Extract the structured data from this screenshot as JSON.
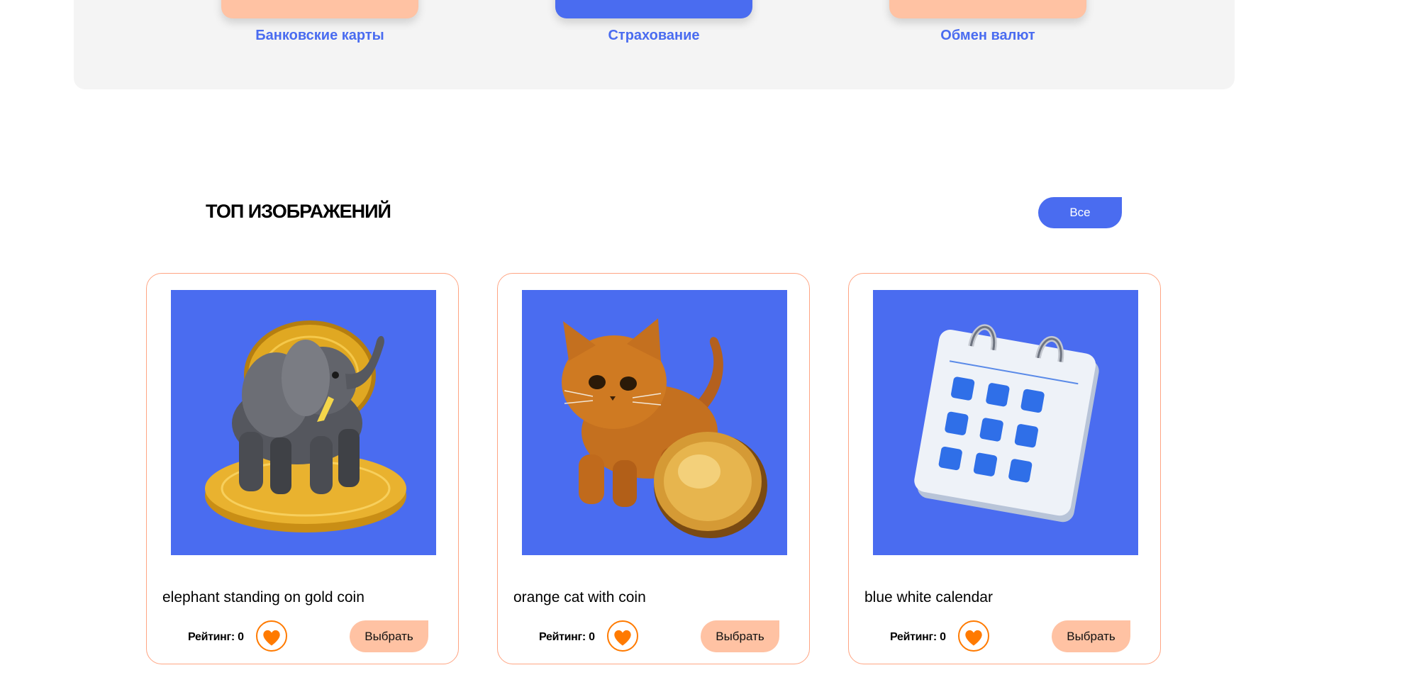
{
  "services": [
    {
      "label": "Банковские карты",
      "tile": "peach"
    },
    {
      "label": "Страхование",
      "tile": "blue"
    },
    {
      "label": "Обмен валют",
      "tile": "peach"
    }
  ],
  "section": {
    "title": "ТОП ИЗОБРАЖЕНИЙ",
    "all_button": "Все"
  },
  "cards": [
    {
      "title": "elephant standing on gold coin",
      "image": "elephant-coin-image",
      "rating": "Рейтинг: 0",
      "choose": "Выбрать"
    },
    {
      "title": "orange cat with coin",
      "image": "cat-coin-image",
      "rating": "Рейтинг: 0",
      "choose": "Выбрать"
    },
    {
      "title": "blue white calendar",
      "image": "calendar-image",
      "rating": "Рейтинг: 0",
      "choose": "Выбрать"
    }
  ],
  "colors": {
    "accent_blue": "#4a6cf0",
    "peach": "#ffc2a3",
    "card_border": "#ffa583",
    "heart_orange": "#ff7a00",
    "panel_bg": "#f4f4f4"
  },
  "icons": {
    "like": "heart-icon"
  }
}
